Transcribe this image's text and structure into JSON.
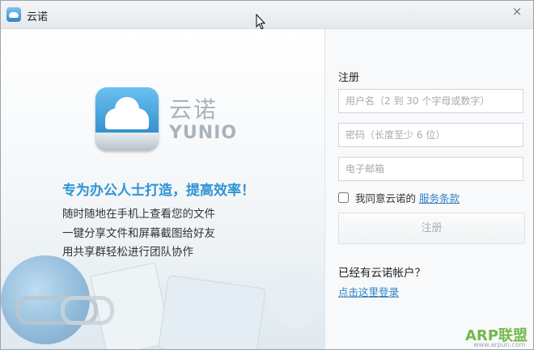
{
  "window": {
    "title": "云诺",
    "close_glyph": "×"
  },
  "brand": {
    "name_cn": "云诺",
    "name_en": "YUNIO"
  },
  "marketing": {
    "slogan": "专为办公人士打造，提高效率！",
    "features": [
      "随时随地在手机上查看您的文件",
      "一键分享文件和屏幕截图给好友",
      "用共享群轻松进行团队协作"
    ]
  },
  "register": {
    "title": "注册",
    "username_placeholder": "用户名（2 到 30 个字母或数字）",
    "password_placeholder": "密码（长度至少 6 位）",
    "email_placeholder": "电子邮箱",
    "agree_text": "我同意云诺的",
    "terms_link": "服务条款",
    "submit_label": "注册"
  },
  "login": {
    "prompt": "已经有云诺帐户？",
    "link": "点击这里登录"
  },
  "watermark": {
    "text": "ARP联盟",
    "url": "www.arpun.com"
  },
  "colors": {
    "accent": "#2d93d6",
    "link": "#2f80c6",
    "logo_blue": "#1f7fc0"
  },
  "icons": [
    "app-cloud-icon",
    "close-icon",
    "mouse-cursor-icon",
    "yunio-logo-icon"
  ]
}
